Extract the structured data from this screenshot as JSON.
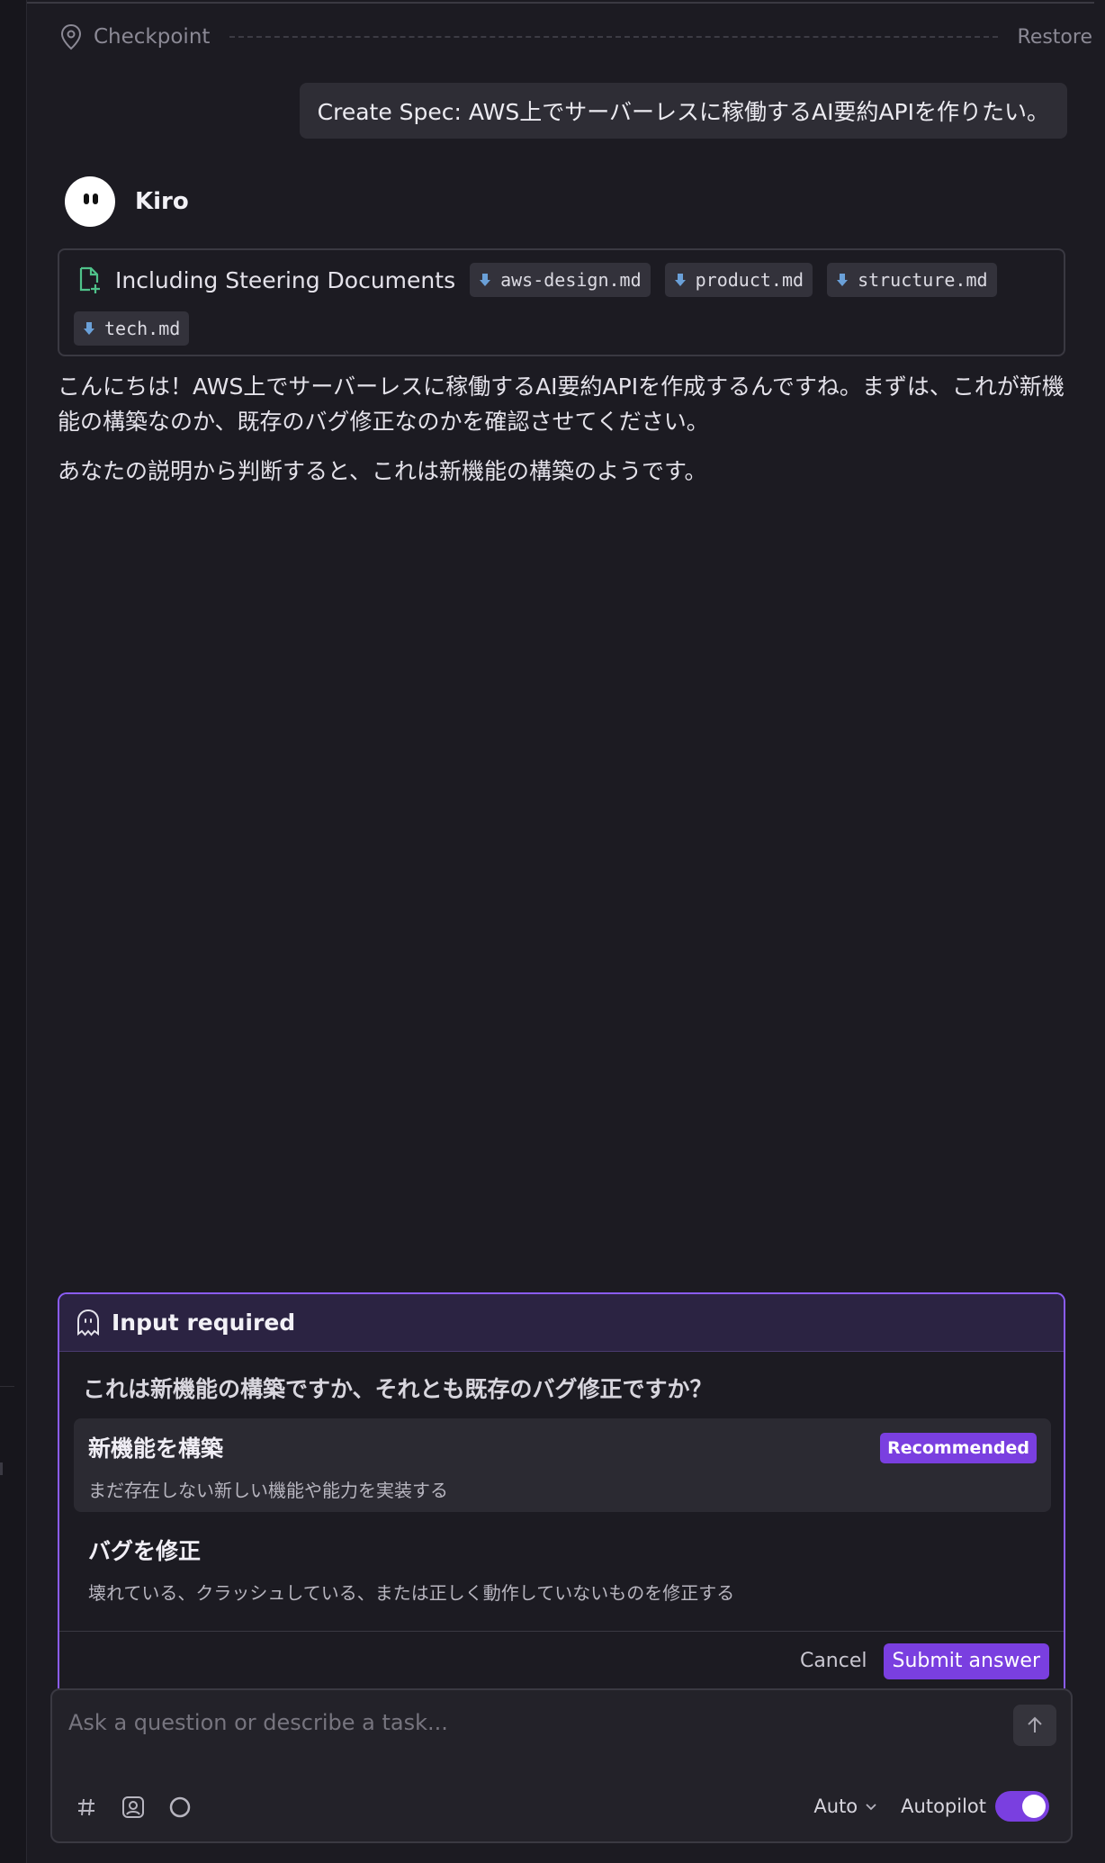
{
  "checkpoint": {
    "label": "Checkpoint",
    "restore_label": "Restore"
  },
  "user_message": "Create Spec: AWS上でサーバーレスに稼働するAI要約APIを作りたい。",
  "assistant": {
    "name": "Kiro"
  },
  "steering": {
    "title": "Including Steering Documents",
    "files": [
      "aws-design.md",
      "product.md",
      "structure.md",
      "tech.md"
    ]
  },
  "answer": {
    "p1": "こんにちは！AWS上でサーバーレスに稼働するAI要約APIを作成するんですね。まずは、これが新機能の構築なのか、既存のバグ修正なのかを確認させてください。",
    "p2": "あなたの説明から判断すると、これは新機能の構築のようです。"
  },
  "input_required": {
    "title": "Input required",
    "question": "これは新機能の構築ですか、それとも既存のバグ修正ですか？",
    "options": [
      {
        "title": "新機能を構築",
        "description": "まだ存在しない新しい機能や能力を実装する",
        "badge": "Recommended"
      },
      {
        "title": "バグを修正",
        "description": "壊れている、クラッシュしている、または正しく動作していないものを修正する"
      }
    ],
    "cancel_label": "Cancel",
    "submit_label": "Submit answer"
  },
  "chat_input": {
    "placeholder": "Ask a question or describe a task...",
    "mode_label": "Auto",
    "autopilot_label": "Autopilot",
    "autopilot_on": true,
    "icons": [
      "hash-icon",
      "image-icon",
      "loading-ring-icon",
      "send-arrow-icon"
    ]
  },
  "colors": {
    "accent": "#7a3fe0",
    "panel_border": "#8a5cf5",
    "background": "#1c1b22"
  }
}
